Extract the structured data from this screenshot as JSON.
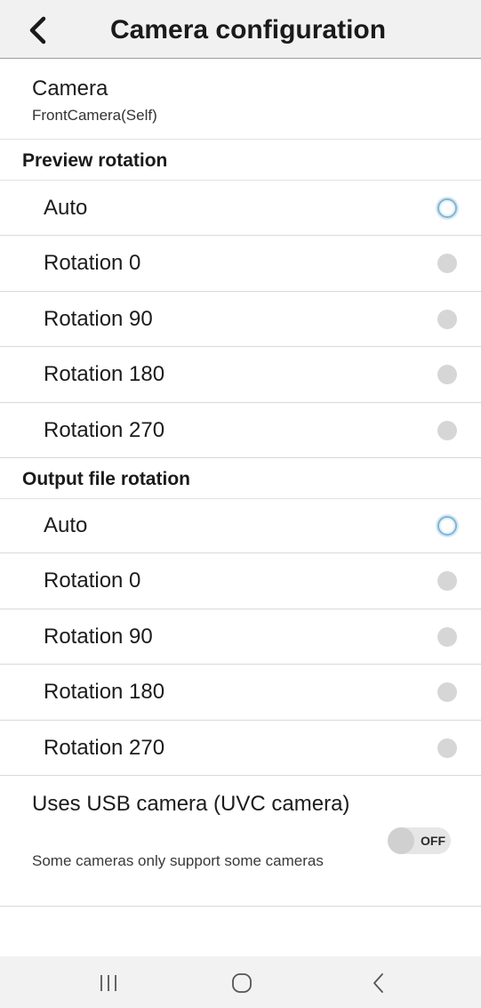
{
  "header": {
    "title": "Camera configuration",
    "back_icon": "chevron-left-icon"
  },
  "camera": {
    "title": "Camera",
    "value": "FrontCamera(Self)"
  },
  "preview_rotation": {
    "header": "Preview rotation",
    "selected": "Auto",
    "options": [
      {
        "label": "Auto",
        "selected": true
      },
      {
        "label": "Rotation 0",
        "selected": false
      },
      {
        "label": "Rotation 90",
        "selected": false
      },
      {
        "label": "Rotation 180",
        "selected": false
      },
      {
        "label": "Rotation 270",
        "selected": false
      }
    ]
  },
  "output_rotation": {
    "header": "Output file rotation",
    "selected": "Auto",
    "options": [
      {
        "label": "Auto",
        "selected": true
      },
      {
        "label": "Rotation 0",
        "selected": false
      },
      {
        "label": "Rotation 90",
        "selected": false
      },
      {
        "label": "Rotation 180",
        "selected": false
      },
      {
        "label": "Rotation 270",
        "selected": false
      }
    ]
  },
  "usb_camera": {
    "title": "Uses USB camera (UVC camera)",
    "description": "Some cameras only support some cameras",
    "toggle_label": "OFF",
    "enabled": false
  },
  "navbar": {
    "recents_icon": "recents-icon",
    "home_icon": "home-icon",
    "back_icon": "back-icon"
  },
  "colors": {
    "appbar_bg": "#f1f1f1",
    "radio_selected_ring": "#7fb6d6",
    "radio_unselected": "#d6d6d6",
    "navbar_bg": "#f2f2f2"
  }
}
